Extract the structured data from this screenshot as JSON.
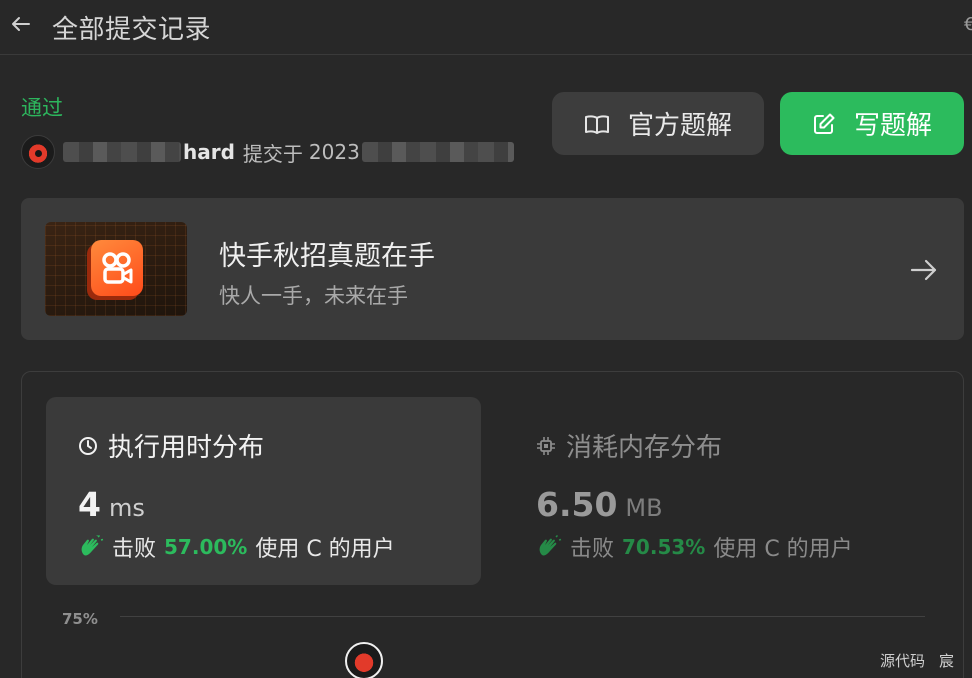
{
  "header": {
    "title": "全部提交记录",
    "edge_glyph": "€"
  },
  "status": {
    "label": "通过",
    "color": "#2db55d"
  },
  "submission": {
    "username_tail": "hard",
    "submitted_label": "提交于",
    "date_prefix": "2023"
  },
  "actions": {
    "official_label": "官方题解",
    "write_label": "写题解",
    "accent": "#2cbb5d"
  },
  "banner": {
    "title": "快手秋招真题在手",
    "subtitle": "快人一手，未来在手"
  },
  "stats": {
    "runtime": {
      "title": "执行用时分布",
      "value": "4",
      "unit": "ms",
      "beat_word": "击败",
      "beat_percent": "57.00%",
      "beat_tail": "使用 C 的用户"
    },
    "memory": {
      "title": "消耗内存分布",
      "value": "6.50",
      "unit": "MB",
      "beat_word": "击败",
      "beat_percent": "70.53%",
      "beat_tail": "使用 C 的用户"
    },
    "axis_tick": "75%"
  },
  "bottom_tabs": [
    "源代码",
    "宸"
  ],
  "icons": {
    "back": "arrow-left-icon",
    "book": "book-icon",
    "edit": "edit-icon",
    "arrow": "arrow-right-icon",
    "clock": "clock-icon",
    "chip": "chip-icon",
    "clap": "clap-icon"
  }
}
